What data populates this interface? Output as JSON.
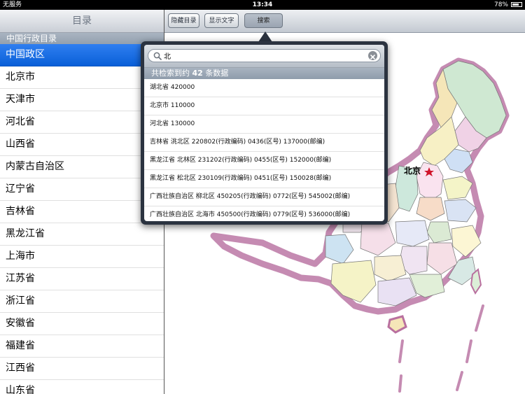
{
  "statusbar": {
    "carrier": "无服务",
    "time": "13:34",
    "battery": "78%",
    "battery_level": 0.78
  },
  "sidebar": {
    "title": "目录",
    "section": "中国行政目录",
    "items": [
      {
        "label": "中国政区",
        "selected": true
      },
      {
        "label": "北京市"
      },
      {
        "label": "天津市"
      },
      {
        "label": "河北省"
      },
      {
        "label": "山西省"
      },
      {
        "label": "内蒙古自治区"
      },
      {
        "label": "辽宁省"
      },
      {
        "label": "吉林省"
      },
      {
        "label": "黑龙江省"
      },
      {
        "label": "上海市"
      },
      {
        "label": "江苏省"
      },
      {
        "label": "浙江省"
      },
      {
        "label": "安徽省"
      },
      {
        "label": "福建省"
      },
      {
        "label": "江西省"
      },
      {
        "label": "山东省"
      }
    ]
  },
  "toolbar": {
    "hide_catalog": "隐藏目录",
    "show_text": "显示文字",
    "search": "搜索"
  },
  "map": {
    "capital_label": "北京"
  },
  "search": {
    "query": "北",
    "result_prefix": "共检索到约",
    "result_count": "42",
    "result_suffix": "条数据",
    "results": [
      "湖北省 420000",
      "北京市 110000",
      "河北省 130000",
      "吉林省 洮北区 220802(行政编码) 0436(区号) 137000(邮编)",
      "黑龙江省 北林区 231202(行政编码) 0455(区号) 152000(邮编)",
      "黑龙江省 松北区 230109(行政编码) 0451(区号) 150028(邮编)",
      "广西壮族自治区 柳北区 450205(行政编码) 0772(区号) 545002(邮编)",
      "广西壮族自治区 北海市 450500(行政编码) 0779(区号) 536000(邮编)"
    ]
  },
  "colors": {
    "selected": "#0a5fd8",
    "popover": "#2b3340",
    "map_border": "#b9709f",
    "capital_star": "#d0142a"
  }
}
